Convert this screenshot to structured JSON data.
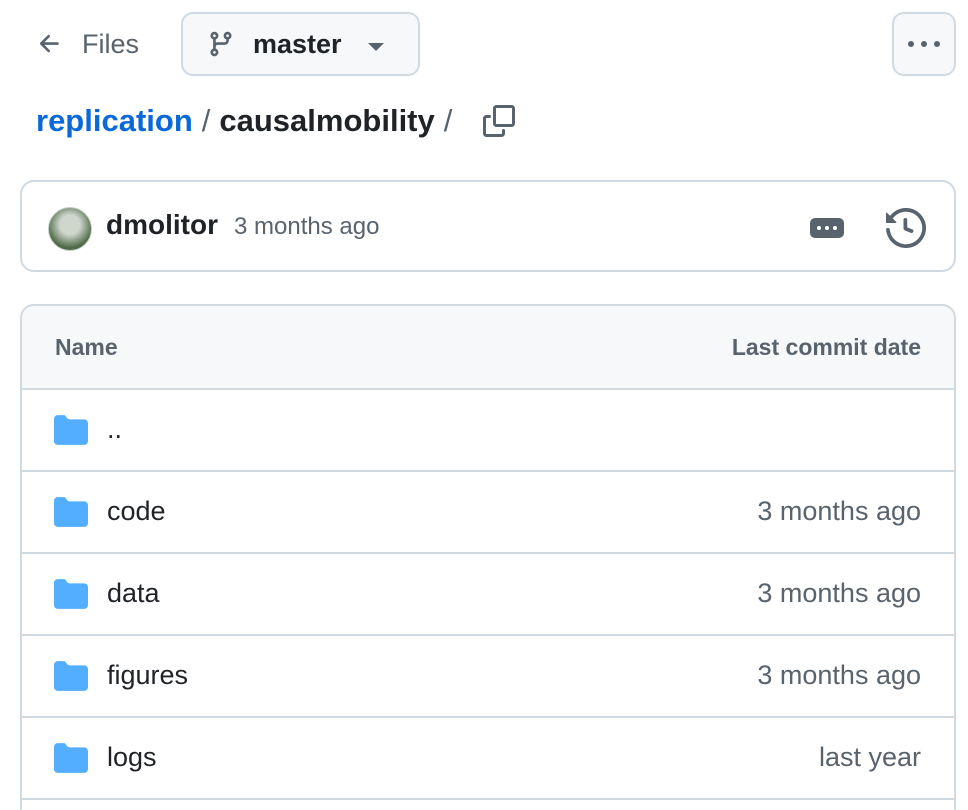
{
  "nav": {
    "back_label": "Files",
    "branch": "master"
  },
  "breadcrumb": {
    "repo": "replication",
    "separator": "/",
    "current": "causalmobility",
    "trailing_separator": "/"
  },
  "commit": {
    "author": "dmolitor",
    "time": "3 months ago"
  },
  "table": {
    "header_name": "Name",
    "header_date": "Last commit date",
    "rows": [
      {
        "name": "..",
        "date": ""
      },
      {
        "name": "code",
        "date": "3 months ago"
      },
      {
        "name": "data",
        "date": "3 months ago"
      },
      {
        "name": "figures",
        "date": "3 months ago"
      },
      {
        "name": "logs",
        "date": "last year"
      }
    ]
  },
  "colors": {
    "link": "#0969da",
    "folder": "#54aeff",
    "muted": "#59636e",
    "border": "#d1d9e0"
  },
  "icons": [
    "arrow-left-icon",
    "git-branch-icon",
    "caret-down-icon",
    "kebab-horizontal-icon",
    "copy-icon",
    "ellipsis-icon",
    "history-icon",
    "folder-icon"
  ]
}
